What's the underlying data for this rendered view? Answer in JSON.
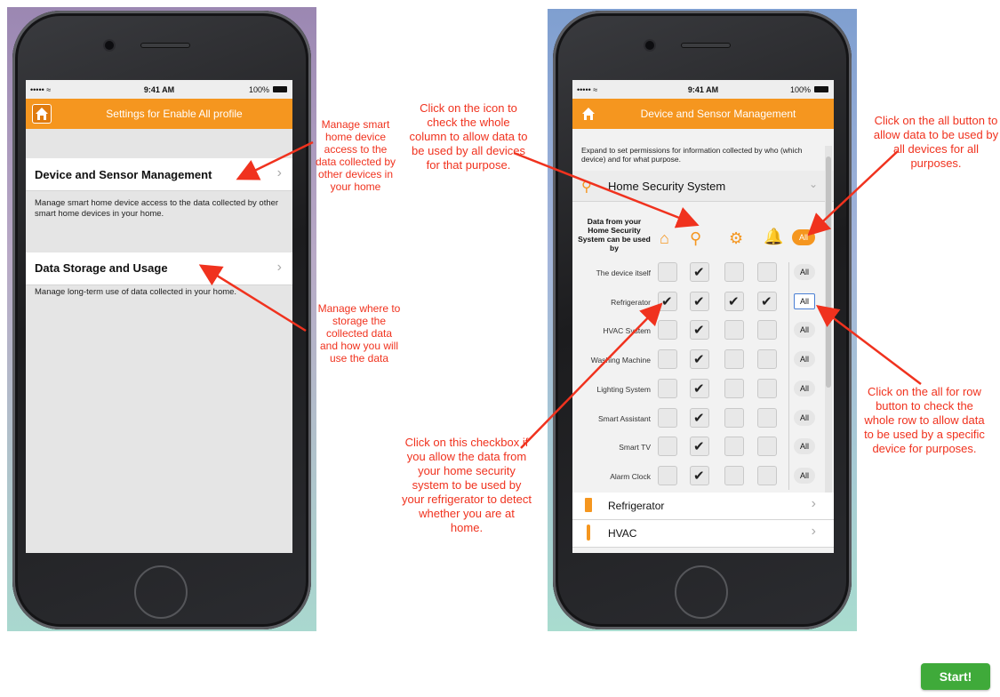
{
  "status": {
    "signal": "••••• ≈",
    "time": "9:41 AM",
    "battery": "100%"
  },
  "left_phone": {
    "header_title": "Settings for Enable All profile",
    "rows": [
      {
        "label": "Device and Sensor Management",
        "desc": "Manage smart home device access to the data collected by other smart home devices in your home."
      },
      {
        "label": "Data Storage and Usage",
        "desc": "Manage long-term use of data collected in your home."
      }
    ]
  },
  "right_phone": {
    "header_title": "Device and Sensor Management",
    "intro": "Expand to set permissions for information collected by who (which device) and for what purpose.",
    "section_title": "Home Security System",
    "grid_header": "Data from your Home Security System can be used by",
    "all_label": "All",
    "devices": [
      {
        "name": "The device itself",
        "checks": [
          false,
          true,
          false,
          false
        ]
      },
      {
        "name": "Refrigerator",
        "checks": [
          true,
          true,
          true,
          true
        ]
      },
      {
        "name": "HVAC System",
        "checks": [
          false,
          true,
          false,
          false
        ]
      },
      {
        "name": "Washing Machine",
        "checks": [
          false,
          true,
          false,
          false
        ]
      },
      {
        "name": "Lighting System",
        "checks": [
          false,
          true,
          false,
          false
        ]
      },
      {
        "name": "Smart Assistant",
        "checks": [
          false,
          true,
          false,
          false
        ]
      },
      {
        "name": "Smart TV",
        "checks": [
          false,
          true,
          false,
          false
        ]
      },
      {
        "name": "Alarm Clock",
        "checks": [
          false,
          true,
          false,
          false
        ]
      }
    ],
    "collapsed_sections": [
      "Refrigerator",
      "HVAC"
    ]
  },
  "annotations": {
    "left_1": "Manage smart home device access to the data collected by other devices in your home",
    "left_2": "Manage where to storage the collected data and how you will use the data",
    "column": "Click on the icon to check the whole column to allow data to be used by all devices for that purpose.",
    "all_button": "Click on the all button to allow data to be used by all devices for all purposes.",
    "checkbox": "Click on this checkbox if you allow the data from your home security system to be used by your refrigerator to detect whether you are at home.",
    "row_button": "Click on the all for row button to check the whole row to allow data to be used by a specific device for purposes."
  },
  "start_label": "Start!",
  "colors": {
    "accent": "#f5961f",
    "annotation": "#f0321e",
    "start": "#3faa3a"
  }
}
